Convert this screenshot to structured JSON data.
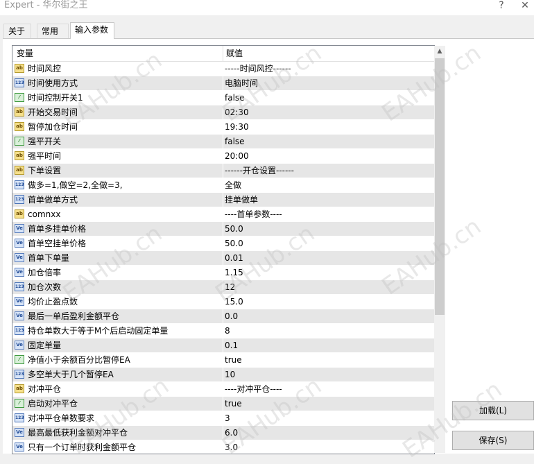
{
  "window": {
    "title": "Expert - 华尔街之王",
    "help": "?",
    "close": "✕"
  },
  "tabs": [
    {
      "label": "关于"
    },
    {
      "label": "常用"
    },
    {
      "label": "输入参数"
    }
  ],
  "table": {
    "headers": {
      "variable": "变量",
      "value": "赋值"
    },
    "rows": [
      {
        "icon": "ab",
        "name": "时间风控",
        "value": "-----时间风控------"
      },
      {
        "icon": "123",
        "name": "时间使用方式",
        "value": "电脑时间"
      },
      {
        "icon": "bool",
        "name": "时间控制开关1",
        "value": "false"
      },
      {
        "icon": "ab",
        "name": "开始交易时间",
        "value": "02:30"
      },
      {
        "icon": "ab",
        "name": "暂停加仓时间",
        "value": "19:30"
      },
      {
        "icon": "bool",
        "name": "强平开关",
        "value": "false"
      },
      {
        "icon": "ab",
        "name": "强平时间",
        "value": "20:00"
      },
      {
        "icon": "ab",
        "name": "下单设置",
        "value": "------开仓设置------"
      },
      {
        "icon": "123",
        "name": "做多=1,做空=2,全做=3,",
        "value": "全做"
      },
      {
        "icon": "123",
        "name": "首单做单方式",
        "value": "挂单做单"
      },
      {
        "icon": "ab",
        "name": "comnxx",
        "value": "----首单参数----"
      },
      {
        "icon": "ve",
        "name": "首单多挂单价格",
        "value": "50.0"
      },
      {
        "icon": "ve",
        "name": "首单空挂单价格",
        "value": "50.0"
      },
      {
        "icon": "ve",
        "name": "首单下单量",
        "value": "0.01"
      },
      {
        "icon": "ve",
        "name": "加仓倍率",
        "value": "1.15"
      },
      {
        "icon": "123",
        "name": "加仓次数",
        "value": "12"
      },
      {
        "icon": "ve",
        "name": "均价止盈点数",
        "value": "15.0"
      },
      {
        "icon": "ve",
        "name": "最后一单后盈利金额平仓",
        "value": "0.0"
      },
      {
        "icon": "123",
        "name": "持仓单数大于等于M个后启动固定单量",
        "value": "8"
      },
      {
        "icon": "ve",
        "name": "固定单量",
        "value": "0.1"
      },
      {
        "icon": "bool",
        "name": "净值小于余额百分比暂停EA",
        "value": "true"
      },
      {
        "icon": "123",
        "name": "多空单大于几个暂停EA",
        "value": "10"
      },
      {
        "icon": "ab",
        "name": "对冲平仓",
        "value": "----对冲平仓----"
      },
      {
        "icon": "bool",
        "name": "启动对冲平仓",
        "value": "true"
      },
      {
        "icon": "123",
        "name": "对冲平仓单数要求",
        "value": "3"
      },
      {
        "icon": "ve",
        "name": "最高最低获利金额对冲平仓",
        "value": "6.0"
      },
      {
        "icon": "ve",
        "name": "只有一个订单时获利金额平仓",
        "value": "3.0"
      }
    ]
  },
  "buttons": {
    "load": "加载(L)",
    "save": "保存(S)"
  },
  "watermark": "EAHub.cn"
}
